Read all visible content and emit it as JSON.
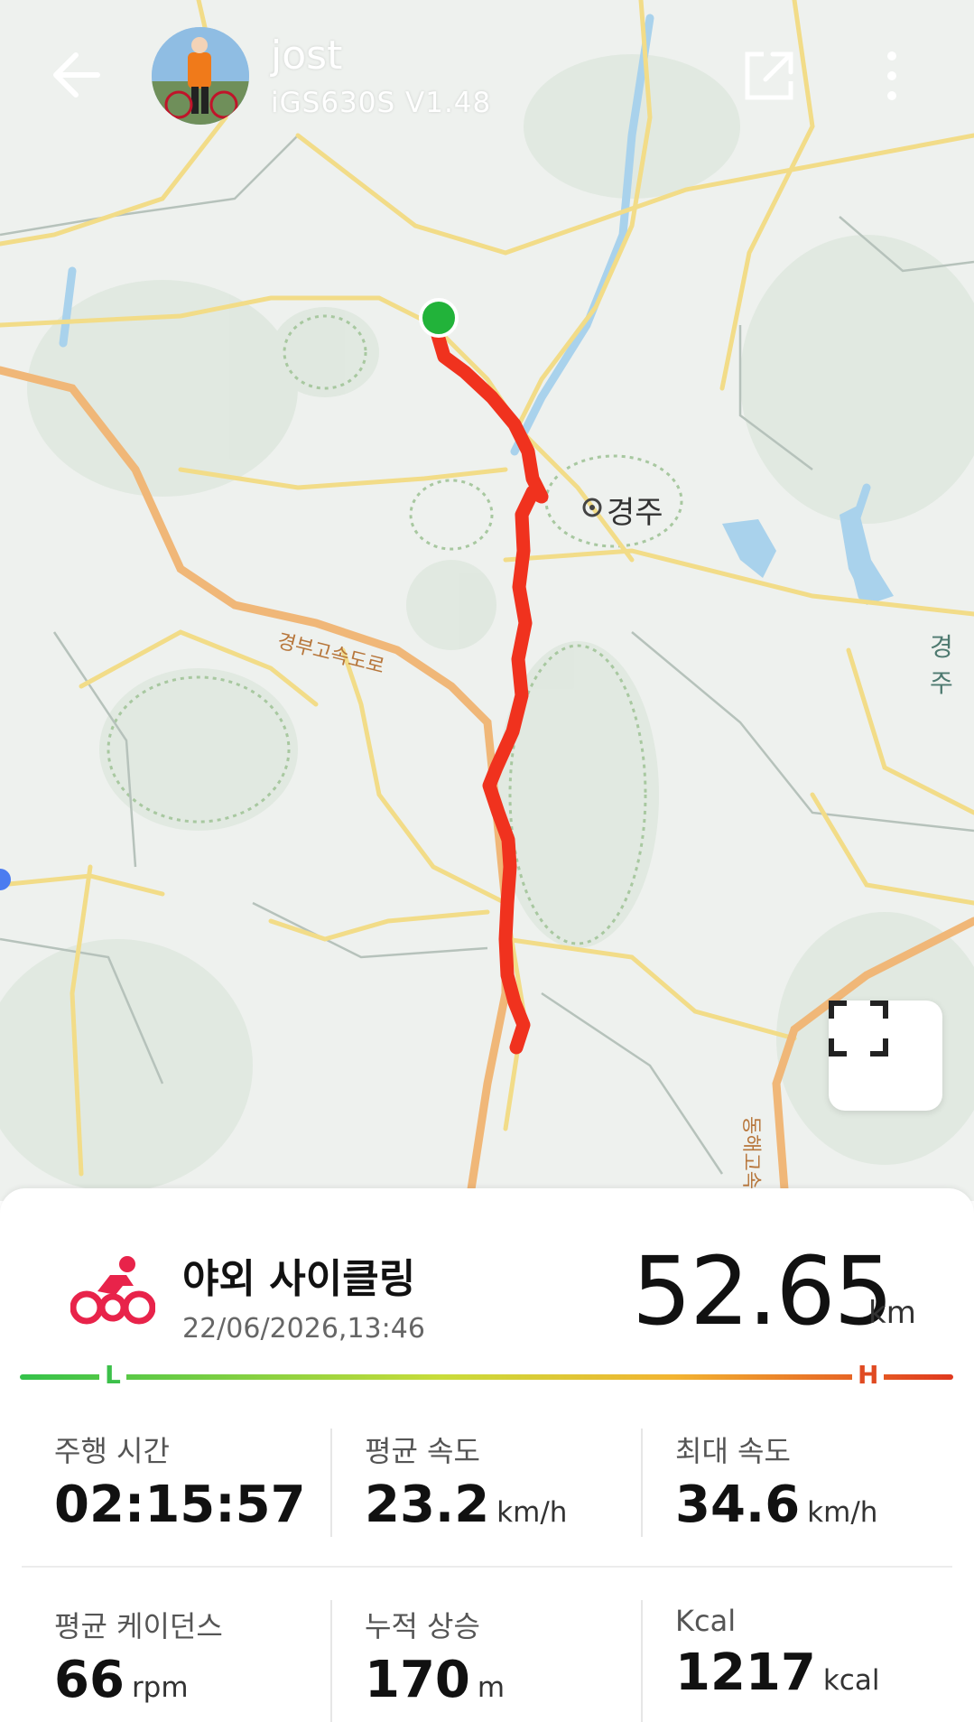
{
  "header": {
    "user_name": "jost",
    "device": "iGS630S  V1.48"
  },
  "map": {
    "city_label": "경주",
    "city_label_right": "경주",
    "highway_label": "경부고속도로",
    "highway_label_east": "동해고속",
    "route_color": "#f0321e",
    "start_color": "#22b33a"
  },
  "activity": {
    "title": "야외 사이클링",
    "datetime": "22/06/2026,13:46",
    "distance_value": "52.65",
    "distance_unit": "km",
    "low_label": "L",
    "high_label": "H",
    "icon_color": "#e8234a"
  },
  "stats": [
    {
      "label": "주행 시간",
      "value": "02:15:57",
      "unit": ""
    },
    {
      "label": "평균 속도",
      "value": "23.2",
      "unit": "km/h"
    },
    {
      "label": "최대 속도",
      "value": "34.6",
      "unit": "km/h"
    },
    {
      "label": "평균 케이던스",
      "value": "66",
      "unit": "rpm"
    },
    {
      "label": "누적 상승",
      "value": "170",
      "unit": "m"
    },
    {
      "label": "Kcal",
      "value": "1217",
      "unit": "kcal"
    }
  ]
}
